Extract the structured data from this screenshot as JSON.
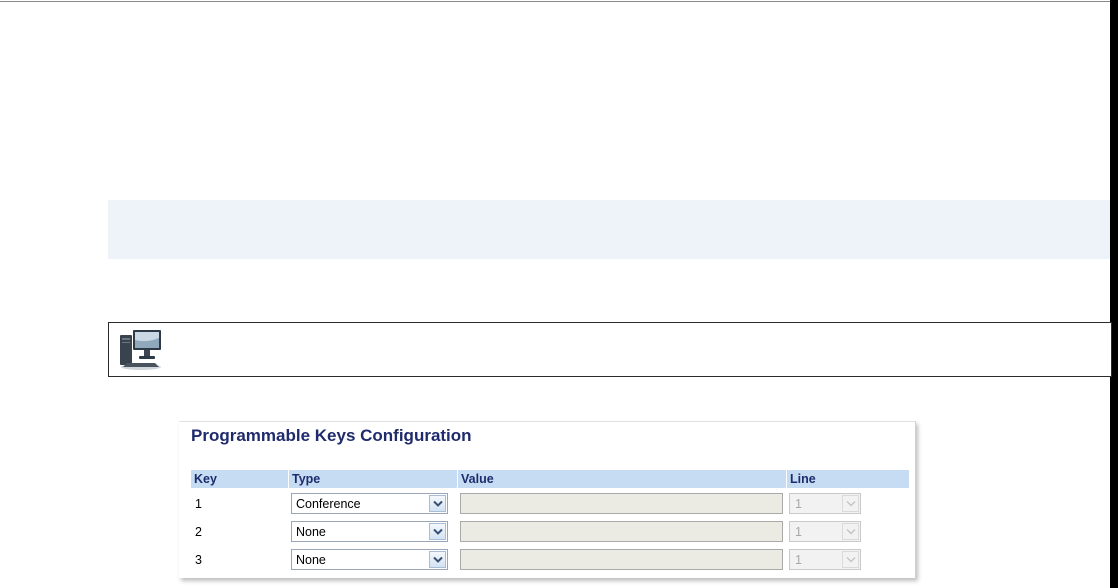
{
  "config": {
    "title": "Programmable Keys Configuration",
    "columns": {
      "key": "Key",
      "type": "Type",
      "value": "Value",
      "line": "Line"
    },
    "rows": [
      {
        "key": "1",
        "type": "Conference",
        "value": "",
        "line": "1"
      },
      {
        "key": "2",
        "type": "None",
        "value": "",
        "line": "1"
      },
      {
        "key": "3",
        "type": "None",
        "value": "",
        "line": "1"
      }
    ]
  },
  "icons": {
    "webui": "desktop-computer-icon",
    "dropdown": "chevron-down-icon"
  },
  "colors": {
    "title": "#1f2b6d",
    "header_bg": "#c5dcf2",
    "info_band": "#eef3fa",
    "disabled_field": "#ebebe4"
  }
}
